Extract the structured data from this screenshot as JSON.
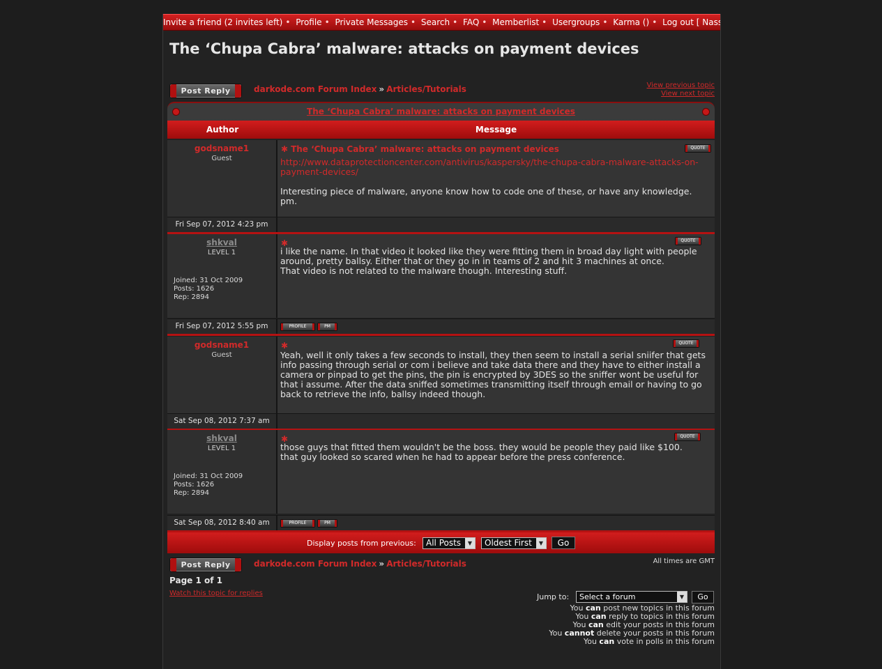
{
  "topnav": {
    "items": [
      "Invite a friend (2 invites left)",
      "Profile",
      "Private Messages",
      "Search",
      "FAQ",
      "Memberlist",
      "Usergroups",
      "Karma ()",
      "Log out [ Nassef ]"
    ]
  },
  "topic": {
    "title": "The ‘Chupa Cabra’ malware: attacks on payment devices",
    "caption": "The ‘Chupa Cabra’ malware: attacks on payment devices"
  },
  "buttons": {
    "post_reply": "Post Reply",
    "quote": "QUOTE",
    "profile": "PROFILE",
    "pm": "PM",
    "go": "Go"
  },
  "breadcrumb": {
    "forum_index": "darkode.com Forum Index",
    "separator": "»",
    "section": "Articles/Tutorials"
  },
  "topic_nav": {
    "prev": "View previous topic",
    "next": "View next topic"
  },
  "table_headers": {
    "author": "Author",
    "message": "Message"
  },
  "posts": [
    {
      "author": "godsname1",
      "rank": "Guest",
      "title": "The ‘Chupa Cabra’ malware: attacks on payment devices",
      "link": "http://www.dataprotectioncenter.com/antivirus/kaspersky/the-chupa-cabra-malware-attacks-on-payment-devices/",
      "body": "Interesting piece of malware, anyone know how to code one of these, or have any knowledge. pm.",
      "date": "Fri Sep 07, 2012 4:23 pm"
    },
    {
      "author": "shkval",
      "rank": "LEVEL 1",
      "joined": "Joined: 31 Oct 2009",
      "posts": "Posts: 1626",
      "rep": "Rep: 2894",
      "body": "i like the name. In that video it looked like they were fitting them in broad day light with people around, pretty ballsy. Either that or they go in in teams of 2 and hit 3 machines at once.\nThat video is not related to the malware though. Interesting stuff.",
      "date": "Fri Sep 07, 2012 5:55 pm"
    },
    {
      "author": "godsname1",
      "rank": "Guest",
      "body": "Yeah, well it only takes a few seconds to install, they then seem to install a serial sniifer that gets info passing through serial or com i believe and take data there and they have to either install a camera or pinpad to get the pins, the pin is encrypted by 3DES so the sniffer wont be useful for that i assume. After the data sniffed sometimes transmitting itself through email or having to go back to retrieve the info, ballsy indeed though.",
      "date": "Sat Sep 08, 2012 7:37 am"
    },
    {
      "author": "shkval",
      "rank": "LEVEL 1",
      "joined": "Joined: 31 Oct 2009",
      "posts": "Posts: 1626",
      "rep": "Rep: 2894",
      "body": "those guys that fitted them wouldn't be the boss. they would be people they paid like $100.\nthat guy looked so scared when he had to appear before the press conference.",
      "date": "Sat Sep 08, 2012 8:40 am"
    }
  ],
  "display": {
    "label": "Display posts from previous:",
    "range": "All Posts",
    "order": "Oldest First"
  },
  "footer": {
    "timezone": "All times are GMT",
    "page": "Page 1 of 1",
    "watch": "Watch this topic for replies",
    "jump_label": "Jump to:",
    "jump_value": "Select a forum",
    "permissions": [
      [
        "You ",
        "can",
        " post new topics in this forum"
      ],
      [
        "You ",
        "can",
        " reply to topics in this forum"
      ],
      [
        "You ",
        "can",
        " edit your posts in this forum"
      ],
      [
        "You ",
        "cannot",
        " delete your posts in this forum"
      ],
      [
        "You ",
        "can",
        " vote in polls in this forum"
      ]
    ]
  }
}
